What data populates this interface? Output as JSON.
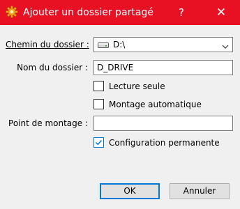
{
  "window": {
    "title": "Ajouter un dossier partagé",
    "help_glyph": "?",
    "close_glyph": "✕",
    "title_icon": "virtualbox-gear-icon",
    "title_bar_color": "#e81123"
  },
  "form": {
    "path_label": "Chemin du dossier :",
    "path_value": "D:\\",
    "path_icon": "hard-drive-icon",
    "name_label": "Nom du dossier :",
    "name_value": "D_DRIVE",
    "mount_label": "Point de montage :",
    "mount_value": ""
  },
  "options": {
    "read_only": {
      "label": "Lecture seule",
      "checked": false
    },
    "auto_mount": {
      "label": "Montage automatique",
      "checked": false
    },
    "permanent": {
      "label": "Configuration permanente",
      "checked": true
    }
  },
  "buttons": {
    "ok": "OK",
    "cancel": "Annuler"
  },
  "colors": {
    "accent": "#0078d7"
  }
}
